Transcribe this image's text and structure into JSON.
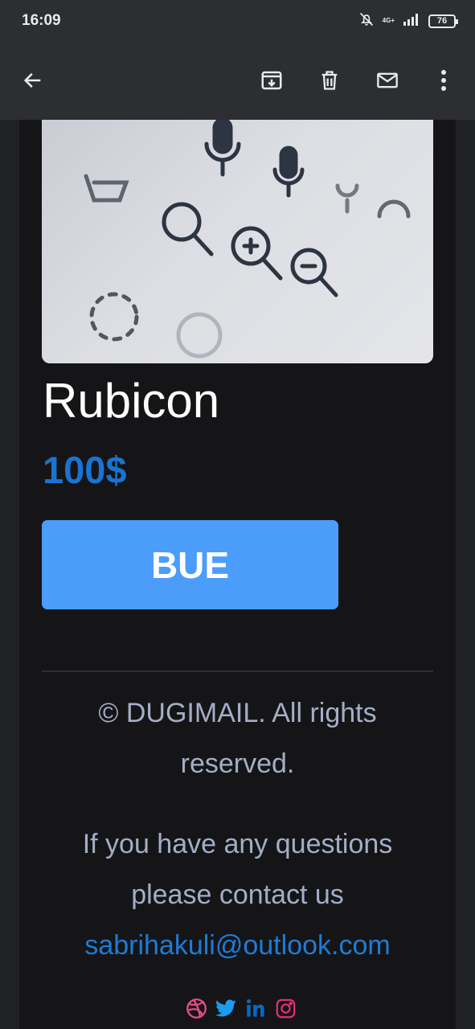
{
  "status": {
    "time": "16:09",
    "network": "4G+",
    "battery": "76"
  },
  "toolbar": {
    "back_icon": "arrow-back-icon",
    "archive_icon": "archive-icon",
    "delete_icon": "trash-icon",
    "mark_unread_icon": "mail-icon",
    "more_icon": "more-vert-icon"
  },
  "product": {
    "title": "Rubicon",
    "price": "100$",
    "buy_label": "BUE"
  },
  "footer": {
    "copyright": "© DUGIMAIL. All rights reserved.",
    "contact_text": "If you have any questions please contact us",
    "email": "sabrihakuli@outlook.com",
    "socials": [
      "dribbble-icon",
      "twitter-icon",
      "linkedin-icon",
      "instagram-icon"
    ]
  },
  "colors": {
    "accent": "#4c9dfa",
    "price": "#1a73d1",
    "link": "#1e7bd6",
    "muted_text": "#a3aec6",
    "card_bg": "#151517"
  }
}
